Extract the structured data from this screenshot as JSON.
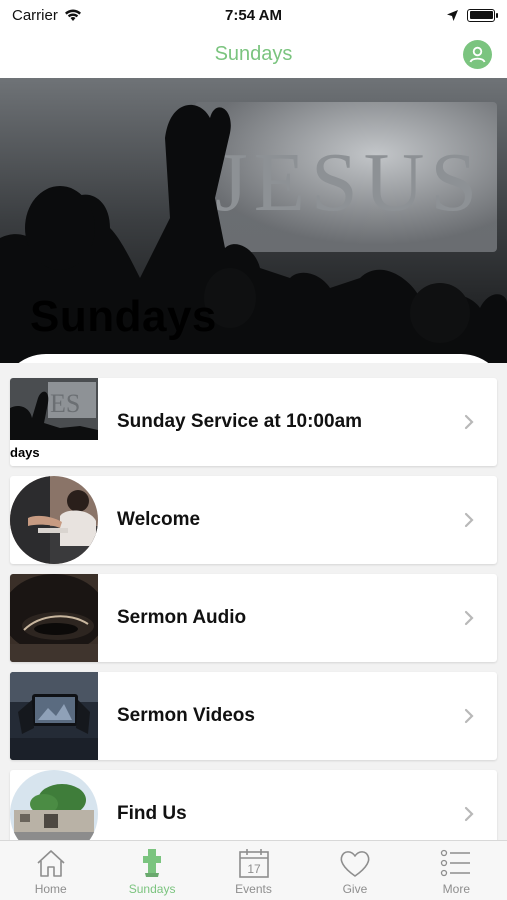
{
  "status_bar": {
    "carrier": "Carrier",
    "time": "7:54 AM"
  },
  "nav": {
    "title": "Sundays"
  },
  "hero": {
    "title": "Sundays"
  },
  "list": {
    "items": [
      {
        "label": "Sunday Service at 10:00am",
        "thumb_caption": "days"
      },
      {
        "label": "Welcome"
      },
      {
        "label": "Sermon Audio"
      },
      {
        "label": "Sermon Videos"
      },
      {
        "label": "Find Us"
      }
    ]
  },
  "tabs": [
    {
      "label": "Home",
      "icon": "home-icon"
    },
    {
      "label": "Sundays",
      "icon": "cross-icon",
      "active": true
    },
    {
      "label": "Events",
      "icon": "calendar-icon",
      "calendar_day": "17"
    },
    {
      "label": "Give",
      "icon": "heart-icon"
    },
    {
      "label": "More",
      "icon": "list-icon"
    }
  ],
  "colors": {
    "accent": "#7bc47f",
    "inactive": "#8e8e8e"
  }
}
